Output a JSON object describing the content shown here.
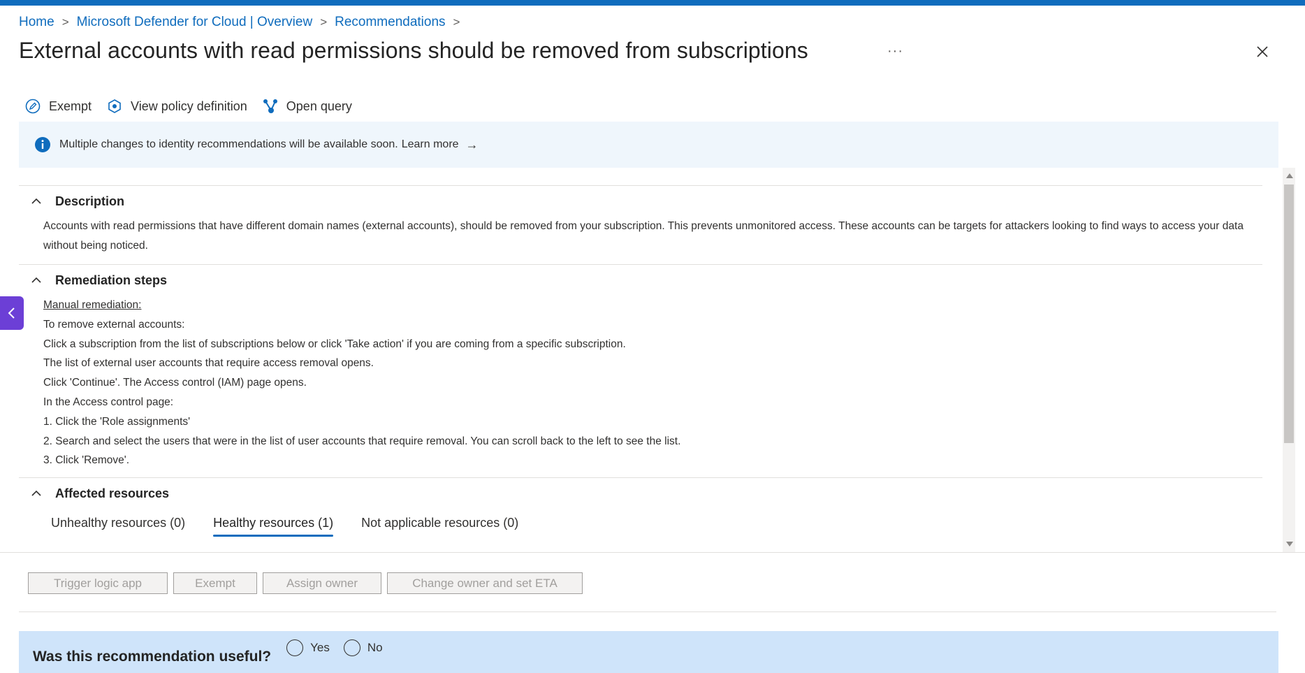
{
  "colors": {
    "accent": "#0f6cbd",
    "banner_bg": "#eff6fc",
    "feedback_bg": "#cfe4fa",
    "side_tab": "#6c3fd6"
  },
  "breadcrumb": [
    {
      "label": "Home"
    },
    {
      "label": "Microsoft Defender for Cloud | Overview"
    },
    {
      "label": "Recommendations"
    }
  ],
  "page": {
    "title": "External accounts with read permissions should be removed from subscriptions",
    "more_label": "···"
  },
  "toolbar": {
    "exempt": {
      "label": "Exempt",
      "icon": "edit-circle-icon"
    },
    "view_policy": {
      "label": "View policy definition",
      "icon": "policy-icon"
    },
    "open_query": {
      "label": "Open query",
      "icon": "query-icon"
    }
  },
  "banner": {
    "text": "Multiple changes to identity recommendations will be available soon.",
    "link": "Learn more",
    "arrow": "→"
  },
  "description": {
    "heading": "Description",
    "text": "Accounts with read permissions that have different domain names (external accounts), should be removed from your subscription. This prevents unmonitored access. These accounts can be targets for attackers looking to find ways to access your data without being noticed."
  },
  "remediation": {
    "heading": "Remediation steps",
    "manual_label": "Manual remediation:",
    "lines": [
      "To remove external accounts:",
      "Click a subscription from the list of subscriptions below or click 'Take action' if you are coming from a specific subscription.",
      "The list of external user accounts that require access removal opens.",
      "Click 'Continue'. The Access control (IAM) page opens.",
      "In the Access control page:",
      "1. Click the 'Role assignments'",
      "2. Search and select the users that were in the list of user accounts that require removal. You can scroll back to the left to see the list.",
      "3. Click 'Remove'."
    ]
  },
  "affected": {
    "heading": "Affected resources",
    "tabs": [
      {
        "label": "Unhealthy resources (0)",
        "active": false
      },
      {
        "label": "Healthy resources (1)",
        "active": true
      },
      {
        "label": "Not applicable resources (0)",
        "active": false
      }
    ]
  },
  "actions": {
    "trigger": "Trigger logic app",
    "exempt": "Exempt",
    "assign": "Assign owner",
    "change": "Change owner and set ETA"
  },
  "feedback": {
    "question": "Was this recommendation useful?",
    "yes": "Yes",
    "no": "No"
  }
}
